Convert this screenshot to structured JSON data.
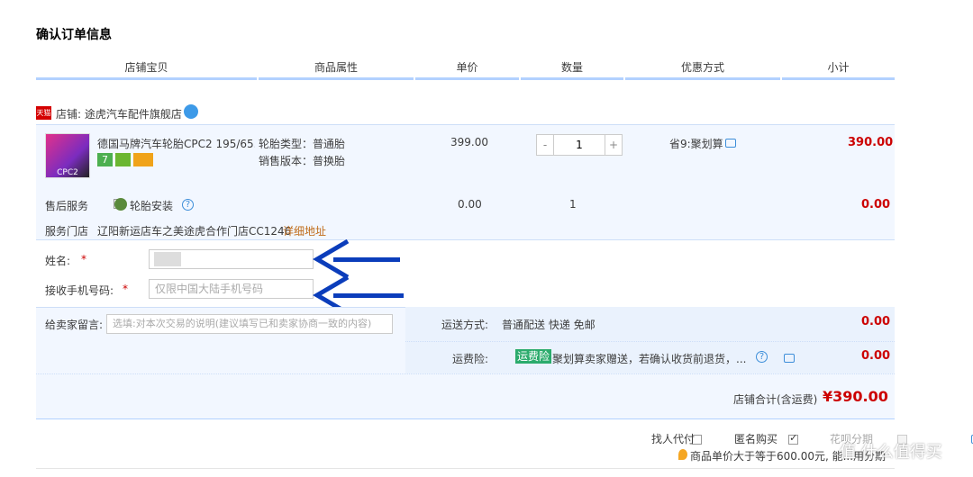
{
  "title": "确认订单信息",
  "columns": [
    "店铺宝贝",
    "商品属性",
    "单价",
    "数量",
    "优惠方式",
    "小计"
  ],
  "shop": {
    "label": "店铺: 途虎汽车配件旗舰店",
    "badge": "天猫"
  },
  "product": {
    "name": "德国马牌汽车轮胎CPC2 195/65...",
    "attr1": "轮胎类型：普通胎",
    "attr2": "销售版本：普换胎",
    "unit_price": "399.00",
    "quantity": "1",
    "minus": "-",
    "plus": "+",
    "discount": "省9:聚划算",
    "subtotal": "390.00",
    "thumb_text": "CPC2"
  },
  "service": {
    "label": "售后服务",
    "option": "轮胎安装",
    "price": "0.00",
    "qty": "1",
    "subtotal": "0.00"
  },
  "store": {
    "label": "服务门店",
    "name": "辽阳新运店车之美途虎合作门店CC1246",
    "link": "详细地址"
  },
  "form": {
    "name_label": "姓名:",
    "phone_label": "接收手机号码:",
    "required": "*",
    "name_value": "",
    "phone_placeholder": "仅限中国大陆手机号码"
  },
  "message": {
    "label": "给卖家留言:",
    "placeholder": "选填:对本次交易的说明(建议填写已和卖家协商一致的内容)"
  },
  "shipping": {
    "label": "运送方式:",
    "value": "普通配送 快递 免邮",
    "price": "0.00"
  },
  "insurance": {
    "label": "运费险:",
    "tag": "运费险",
    "text": "聚划算卖家赠送，若确认收货前退货，...",
    "price": "0.00"
  },
  "total": {
    "label": "店铺合计(含运费)",
    "value": "¥390.00"
  },
  "footer": {
    "option1": "找人代付",
    "option2": "匿名购买",
    "option3": "花呗分期",
    "note": "商品单价大于等于600.00元, 能...用分期",
    "watermark": "值 什么值得买"
  }
}
